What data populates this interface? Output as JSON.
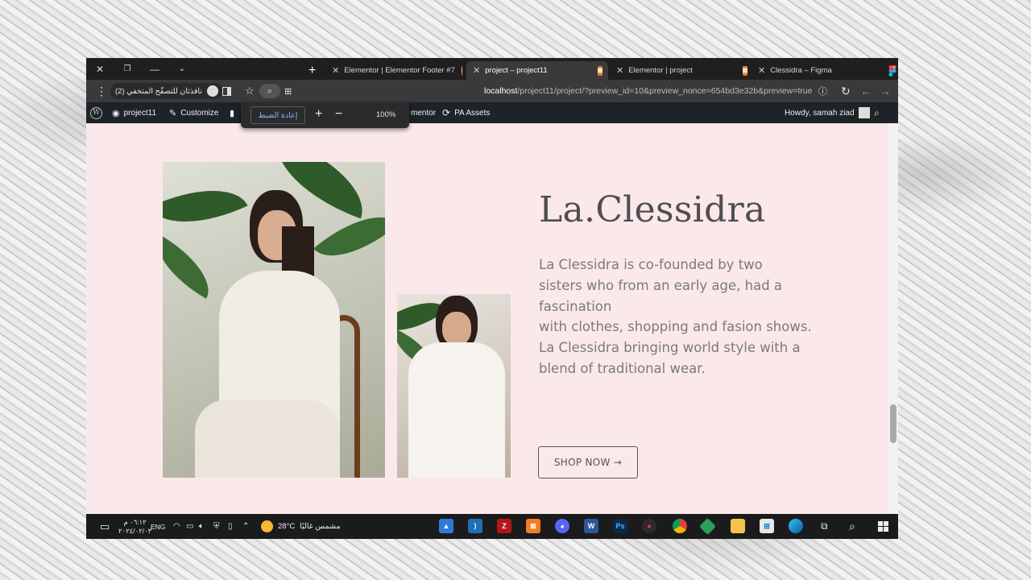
{
  "browser": {
    "tabs": [
      {
        "title": "Elementor | Elementor Footer #7",
        "active": false
      },
      {
        "title": "project – project11",
        "active": true
      },
      {
        "title": "Elementor | project",
        "active": false
      },
      {
        "title": "Clessidra – Figma",
        "active": false
      }
    ],
    "new_tab": "+",
    "profile_label": "نافذتان للتصفّح المتخفي (2)",
    "url_host": "localhost",
    "url_path": "/project11/project/?preview_id=10&preview_nonce=654bd3e32b&preview=true"
  },
  "zoom_popup": {
    "reset_label": "إعادة الضبط",
    "plus": "+",
    "minus": "−",
    "level": "100%"
  },
  "wp_admin_bar": {
    "site_name": "project11",
    "customize": "Customize",
    "elementor_partial": "mentor",
    "pa_assets": "PA Assets",
    "howdy": "Howdy, samah ziad"
  },
  "content": {
    "title": "La.Clessidra",
    "description_lines": [
      "La Clessidra is co-founded by two",
      "sisters who from an early age, had a",
      "fascination",
      "with clothes, shopping and fasion shows.",
      "La Clessidra bringing world style with a",
      "blend of traditional wear."
    ],
    "shop_button": "SHOP NOW →"
  },
  "taskbar": {
    "time": "٠٦:١٢ م",
    "date": "٢٠٢٤/٠٢/٠٣",
    "lang": "ENG",
    "weather_temp": "28°C",
    "weather_desc": "مشمس غالبًا"
  },
  "colors": {
    "page_bg": "#fbe8eb",
    "title_text": "#4e4e4e",
    "body_text": "#7a7a7a",
    "admin_bar": "#1d2327",
    "tab_strip": "#1f1f20"
  }
}
